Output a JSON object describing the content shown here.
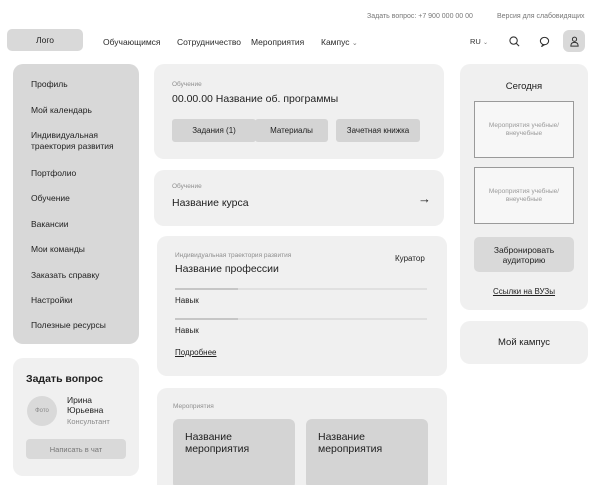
{
  "top_bar": {
    "ask_question": "Задать вопрос: +7 900 000 00 00",
    "accessibility": "Версия для слабовидящих"
  },
  "header": {
    "logo": "Лого",
    "nav": [
      "Обучающимся",
      "Сотрудничество",
      "Мероприятия",
      "Кампус"
    ],
    "lang": "RU",
    "icons": [
      "search-icon",
      "chat-icon",
      "user-icon"
    ]
  },
  "sidebar": {
    "items": [
      "Профиль",
      "Мой календарь",
      "Индивидуальная траектория развития",
      "Портфолио",
      "Обучение",
      "Вакансии",
      "Мои команды",
      "Заказать справку",
      "Настройки",
      "Полезные ресурсы"
    ]
  },
  "ask_card": {
    "title": "Задать вопрос",
    "photo_label": "Фото",
    "name": "Ирина Юрьевна",
    "role": "Консультант",
    "button": "Написать в чат"
  },
  "program_card": {
    "label": "Обучение",
    "title": "00.00.00  Название об. программы",
    "buttons": [
      "Задания  (1)",
      "Материалы",
      "Зачетная книжка"
    ]
  },
  "course_card": {
    "label": "Обучение",
    "title": "Название курса",
    "arrow": "→"
  },
  "trajectory_card": {
    "label": "Индивидуальная траектория развития",
    "title": "Название профессии",
    "curator": "Куратор",
    "skills": [
      {
        "name": "Навык",
        "progress": 0.25
      },
      {
        "name": "Навык",
        "progress": 0.25
      }
    ],
    "more_link": "Подробнее"
  },
  "events_card": {
    "label": "Мероприятия",
    "events": [
      "Название мероприятия",
      "Название мероприятия"
    ]
  },
  "today_card": {
    "title": "Сегодня",
    "boxes": [
      "Мероприятия учебные/ внеучебные",
      "Мероприятия учебные/ внеучебные"
    ],
    "book_button": "Забронировать аудиторию",
    "universities_link": "Ссылки на ВУЗы"
  },
  "campus_card": {
    "title": "Мой кампус"
  }
}
